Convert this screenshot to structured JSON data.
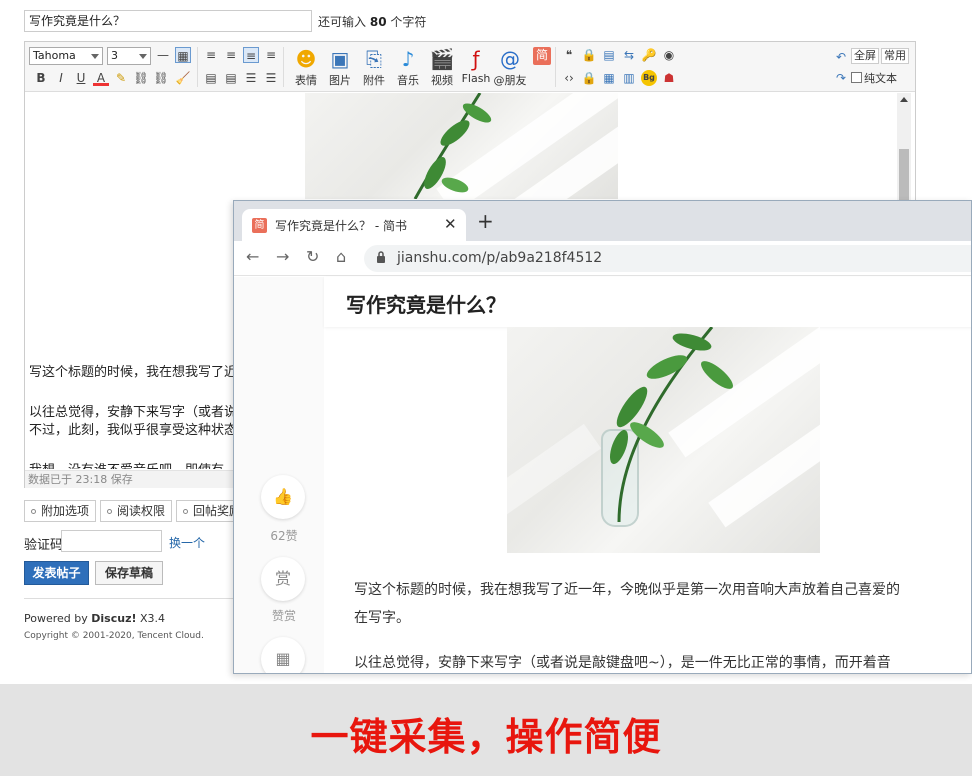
{
  "post_title": {
    "value": "写作究竟是什么？",
    "remaining_label_before": "还可输入",
    "remaining_count": "80",
    "remaining_label_after": "个字符"
  },
  "toolbar": {
    "font_family": "Tahoma",
    "font_size": "3",
    "format_icons": [
      "B",
      "I",
      "U",
      "A"
    ],
    "big_buttons": [
      {
        "label": "表情",
        "icon": "smiley-icon"
      },
      {
        "label": "图片",
        "icon": "image-icon"
      },
      {
        "label": "附件",
        "icon": "paperclip-icon"
      },
      {
        "label": "音乐",
        "icon": "music-icon"
      },
      {
        "label": "视频",
        "icon": "video-icon"
      },
      {
        "label": "Flash",
        "icon": "flash-icon"
      },
      {
        "label": "@朋友",
        "icon": "at-icon"
      }
    ],
    "fullscreen_label": "全屏",
    "common_label": "常用",
    "plain_text_label": "纯文本"
  },
  "editor": {
    "paragraphs": [
      "写这个标题的时候，我在想我写了近",
      "以往总觉得，安静下来写字（或者说",
      "不过，此刻，我似乎很享受这种状态",
      "我想，没有谁不爱音乐吧，即使有"
    ],
    "status": "数据已于 23:18 保存"
  },
  "options": {
    "extra": "附加选项",
    "read_perm": "阅读权限",
    "reply_reward": "回帖奖励"
  },
  "captcha": {
    "label": "验证码",
    "change": "换一个"
  },
  "actions": {
    "submit": "发表帖子",
    "save_draft": "保存草稿"
  },
  "footer": {
    "powered_prefix": "Powered by",
    "brand": "Discuz!",
    "version": "X3.4",
    "copyright": "Copyright © 2001-2020, Tencent Cloud."
  },
  "browser": {
    "tab_title": "写作究竟是什么？ - 简书",
    "tab_favicon": "简",
    "url": "jianshu.com/p/ab9a218f4512",
    "article_title": "写作究竟是什么？",
    "like_count": "62赞",
    "reward_symbol": "赏",
    "reward_label": "赞赏",
    "para1_line1": "写这个标题的时候，我在想我写了近一年，今晚似乎是第一次用音响大声放着自己喜爱的",
    "para1_line2": "在写字。",
    "para2_line1": "以往总觉得，安静下来写字（或者说是敲键盘吧~），是一件无比正常的事情，而开着音"
  },
  "banner": {
    "slogan": "一键采集，操作简便"
  },
  "colors": {
    "accent_blue": "#2e6fba",
    "slogan_red": "#e8160e",
    "jianshu_brand": "#ea6f5a"
  }
}
